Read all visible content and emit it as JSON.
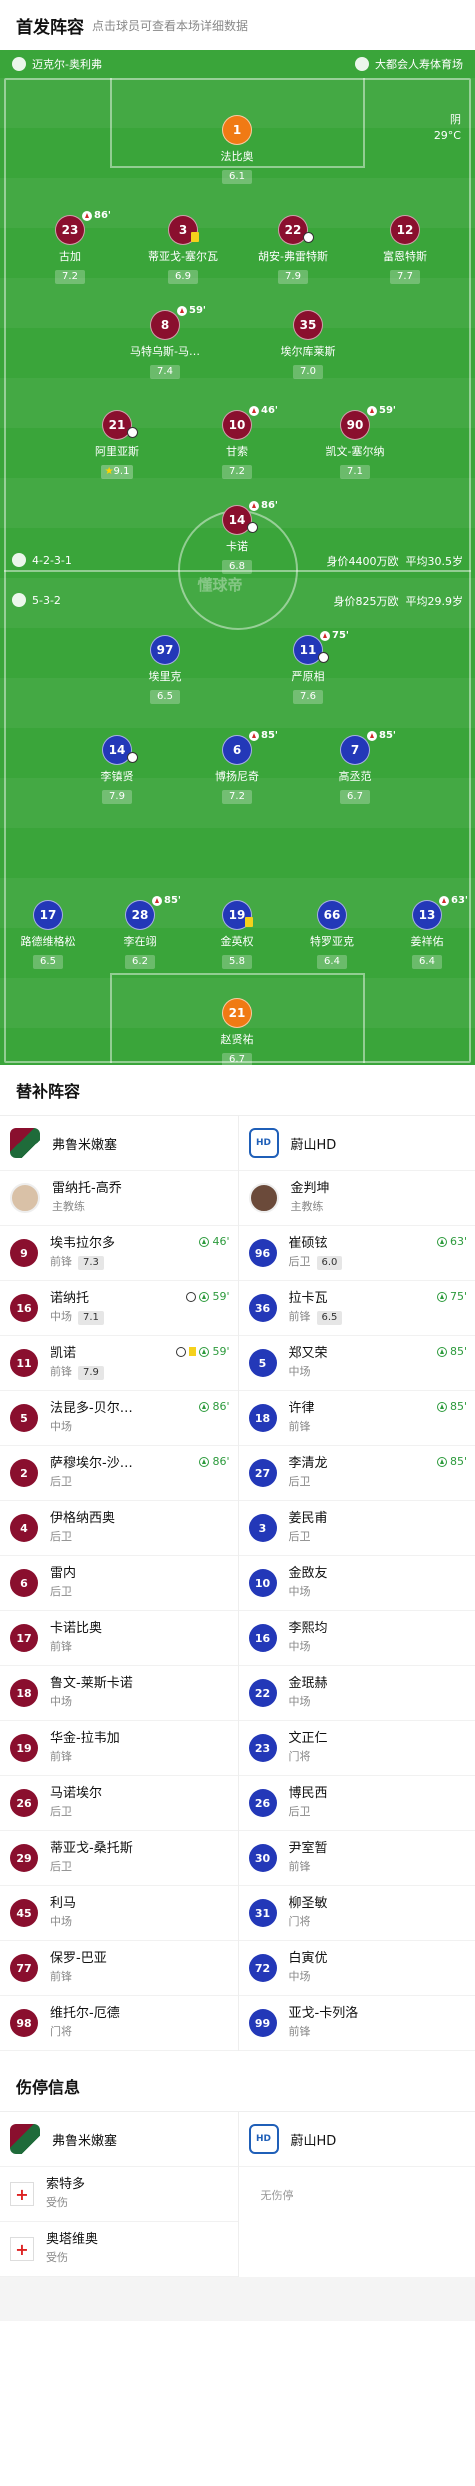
{
  "header": {
    "title": "首发阵容",
    "subtitle": "点击球员可查看本场详细数据"
  },
  "match": {
    "home_team": "迈克尔-奥利弗",
    "venue": "大都会人寿体育场",
    "weather": "阴",
    "temp": "29°C",
    "watermark": "懂球帝"
  },
  "home_lineup": {
    "formation": "4-2-3-1",
    "value": "身价4400万欧",
    "age": "平均30.5岁"
  },
  "away_lineup": {
    "formation": "5-3-2",
    "value": "身价825万欧",
    "age": "平均29.9岁"
  },
  "home_players": [
    {
      "num": "1",
      "name": "法比奥",
      "rating": "6.1",
      "pos": "gk"
    },
    {
      "num": "23",
      "name": "古加",
      "rating": "7.2",
      "sub": "86'"
    },
    {
      "num": "3",
      "name": "蒂亚戈-塞尔瓦",
      "rating": "6.9",
      "card": "yc"
    },
    {
      "num": "22",
      "name": "胡安-弗雷特斯",
      "rating": "7.9",
      "ball": true
    },
    {
      "num": "12",
      "name": "富恩特斯",
      "rating": "7.7"
    },
    {
      "num": "8",
      "name": "马特乌斯-马…",
      "rating": "7.4",
      "sub": "59'"
    },
    {
      "num": "35",
      "name": "埃尔库莱斯",
      "rating": "7.0"
    },
    {
      "num": "21",
      "name": "阿里亚斯",
      "rating": "9.1",
      "ball": true,
      "best": true
    },
    {
      "num": "10",
      "name": "甘索",
      "rating": "7.2",
      "sub": "46'"
    },
    {
      "num": "90",
      "name": "凯文-塞尔纳",
      "rating": "7.1",
      "sub": "59'"
    },
    {
      "num": "14",
      "name": "卡诺",
      "rating": "6.8",
      "sub": "86'",
      "ball": true
    }
  ],
  "away_players": [
    {
      "num": "97",
      "name": "埃里克",
      "rating": "6.5"
    },
    {
      "num": "11",
      "name": "严原相",
      "rating": "7.6",
      "sub": "75'",
      "ball": true
    },
    {
      "num": "14",
      "name": "李镇贤",
      "rating": "7.9",
      "ball": true
    },
    {
      "num": "6",
      "name": "博扬尼奇",
      "rating": "7.2",
      "sub": "85'"
    },
    {
      "num": "7",
      "name": "高丞范",
      "rating": "6.7",
      "sub": "85'"
    },
    {
      "num": "17",
      "name": "路德维格松",
      "rating": "6.5"
    },
    {
      "num": "28",
      "name": "李在翊",
      "rating": "6.2",
      "sub": "85'"
    },
    {
      "num": "19",
      "name": "金英权",
      "rating": "5.8",
      "card": "yc"
    },
    {
      "num": "66",
      "name": "特罗亚克",
      "rating": "6.4"
    },
    {
      "num": "13",
      "name": "姜祥佑",
      "rating": "6.4",
      "sub": "63'"
    },
    {
      "num": "21",
      "name": "赵贤祐",
      "rating": "6.7",
      "pos": "gk"
    }
  ],
  "subs": {
    "title": "替补阵容",
    "home_team": "弗鲁米嫩塞",
    "away_team": "蔚山HD",
    "home_coach": {
      "name": "雷纳托-高乔",
      "role": "主教练"
    },
    "away_coach": {
      "name": "金判坤",
      "role": "主教练"
    },
    "home": [
      {
        "num": "9",
        "name": "埃韦拉尔多",
        "pos": "前锋",
        "score": "7.3",
        "time": "46'"
      },
      {
        "num": "16",
        "name": "诺纳托",
        "pos": "中场",
        "score": "7.1",
        "time": "59'",
        "ball": true
      },
      {
        "num": "11",
        "name": "凯诺",
        "pos": "前锋",
        "score": "7.9",
        "time": "59'",
        "ball": true,
        "yc": true
      },
      {
        "num": "5",
        "name": "法昆多-贝尔…",
        "pos": "中场",
        "time": "86'"
      },
      {
        "num": "2",
        "name": "萨穆埃尔-沙…",
        "pos": "后卫",
        "time": "86'"
      },
      {
        "num": "4",
        "name": "伊格纳西奥",
        "pos": "后卫"
      },
      {
        "num": "6",
        "name": "雷内",
        "pos": "后卫"
      },
      {
        "num": "17",
        "name": "卡诺比奥",
        "pos": "前锋"
      },
      {
        "num": "18",
        "name": "鲁文-莱斯卡诺",
        "pos": "中场"
      },
      {
        "num": "19",
        "name": "华金-拉韦加",
        "pos": "前锋"
      },
      {
        "num": "26",
        "name": "马诺埃尔",
        "pos": "后卫"
      },
      {
        "num": "29",
        "name": "蒂亚戈-桑托斯",
        "pos": "后卫"
      },
      {
        "num": "45",
        "name": "利马",
        "pos": "中场"
      },
      {
        "num": "77",
        "name": "保罗-巴亚",
        "pos": "前锋"
      },
      {
        "num": "98",
        "name": "维托尔-厄德",
        "pos": "门将"
      }
    ],
    "away": [
      {
        "num": "96",
        "name": "崔硕铉",
        "pos": "后卫",
        "score": "6.0",
        "time": "63'"
      },
      {
        "num": "36",
        "name": "拉卡瓦",
        "pos": "前锋",
        "score": "6.5",
        "time": "75'"
      },
      {
        "num": "5",
        "name": "郑又荣",
        "pos": "中场",
        "time": "85'"
      },
      {
        "num": "18",
        "name": "许律",
        "pos": "前锋",
        "time": "85'"
      },
      {
        "num": "27",
        "name": "李清龙",
        "pos": "后卫",
        "time": "85'"
      },
      {
        "num": "3",
        "name": "姜民甫",
        "pos": "后卫"
      },
      {
        "num": "10",
        "name": "金敃友",
        "pos": "中场"
      },
      {
        "num": "16",
        "name": "李熙均",
        "pos": "中场"
      },
      {
        "num": "22",
        "name": "金珉赫",
        "pos": "中场"
      },
      {
        "num": "23",
        "name": "文正仁",
        "pos": "门将"
      },
      {
        "num": "26",
        "name": "博民西",
        "pos": "后卫"
      },
      {
        "num": "30",
        "name": "尹室暂",
        "pos": "前锋"
      },
      {
        "num": "31",
        "name": "柳圣敏",
        "pos": "门将"
      },
      {
        "num": "72",
        "name": "白寅优",
        "pos": "中场"
      },
      {
        "num": "99",
        "name": "亚戈-卡列洛",
        "pos": "前锋"
      }
    ]
  },
  "injuries": {
    "title": "伤停信息",
    "home_team": "弗鲁米嫩塞",
    "away_team": "蔚山HD",
    "home": [
      {
        "name": "索特多",
        "reason": "受伤"
      },
      {
        "name": "奥塔维奥",
        "reason": "受伤"
      }
    ],
    "away_none": "无伤停"
  },
  "colors": {
    "pitch": "#3aa53a",
    "home": "#8a0f2e",
    "away": "#2338b8",
    "gk": "#f07a14"
  }
}
